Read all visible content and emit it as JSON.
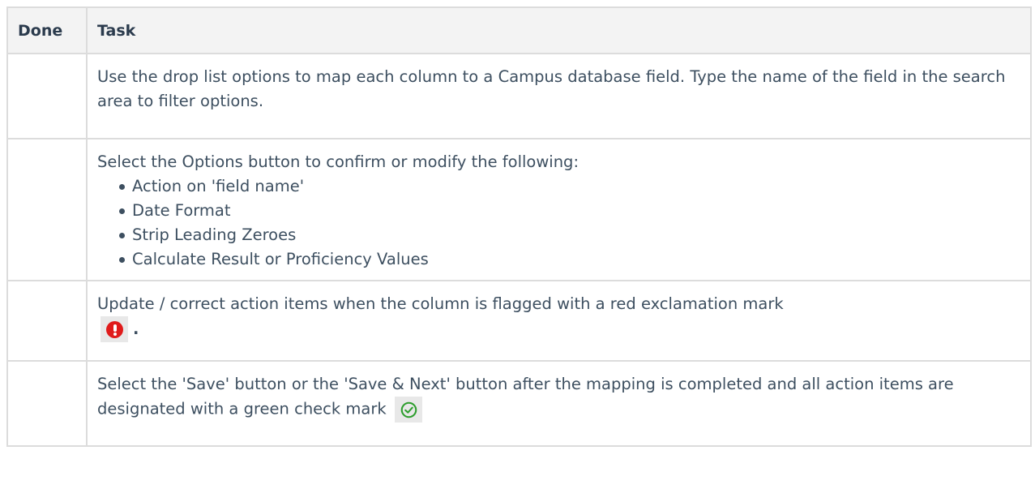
{
  "table": {
    "headers": {
      "done": "Done",
      "task": "Task"
    },
    "rows": [
      {
        "done": "",
        "task": "Use the drop list options to map each column to a Campus database field. Type the name of the field in the search area to filter options."
      },
      {
        "done": "",
        "task_intro": "Select the Options button to confirm or modify the following:",
        "bullets": [
          "Action on 'field name'",
          "Date Format",
          "Strip Leading Zeroes",
          "Calculate Result or Proficiency Values"
        ]
      },
      {
        "done": "",
        "task": "Update / correct action items when the column is flagged with a red exclamation mark",
        "icon": "red-exclamation-icon",
        "trailing": "."
      },
      {
        "done": "",
        "task": "Select the 'Save' button or the 'Save & Next' button after the mapping is completed and all action items are designated with a green check mark",
        "icon": "green-check-icon"
      }
    ]
  },
  "colors": {
    "text": "#3d4f60",
    "header_bg": "#f3f3f3",
    "border": "#dcdcdc",
    "alert_red": "#e01b1b",
    "check_green": "#2e9e2e",
    "icon_bg": "#e8e8e8"
  }
}
